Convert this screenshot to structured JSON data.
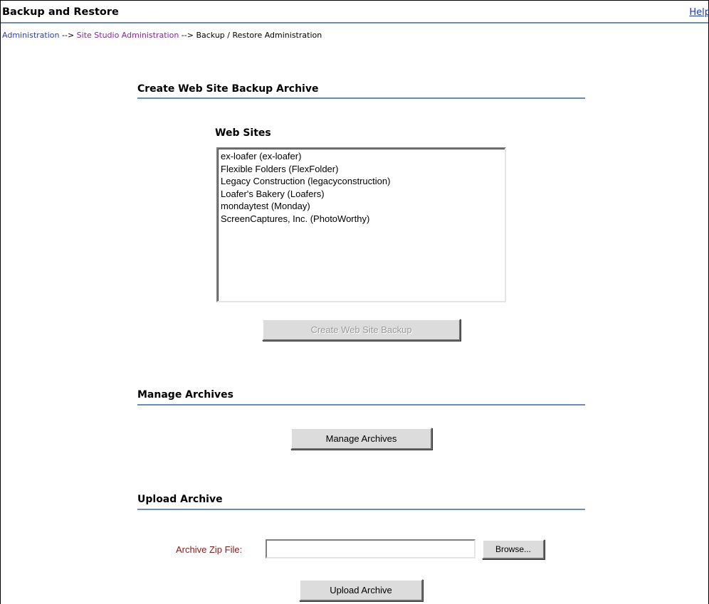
{
  "header": {
    "title": "Backup and Restore",
    "help_label": "Help"
  },
  "breadcrumb": {
    "items": [
      "Administration",
      "Site Studio Administration",
      "Backup / Restore Administration"
    ],
    "separator": "-->"
  },
  "backup_section": {
    "title": "Create Web Site Backup Archive",
    "list_heading": "Web Sites",
    "sites": [
      "ex-loafer (ex-loafer)",
      "Flexible Folders (FlexFolder)",
      "Legacy Construction (legacyconstruction)",
      "Loafer's Bakery (Loafers)",
      "mondaytest (Monday)",
      "ScreenCaptures, Inc. (PhotoWorthy)"
    ],
    "button_label": "Create Web Site Backup",
    "button_enabled": false
  },
  "manage_section": {
    "title": "Manage Archives",
    "button_label": "Manage Archives"
  },
  "upload_section": {
    "title": "Upload Archive",
    "field_label": "Archive Zip File:",
    "field_value": "",
    "browse_label": "Browse...",
    "button_label": "Upload Archive"
  },
  "colors": {
    "rule": "#6a8ac2",
    "link": "#2b3fb0",
    "visited_link": "#8a1fb0",
    "field_label": "#8b1a1a"
  }
}
